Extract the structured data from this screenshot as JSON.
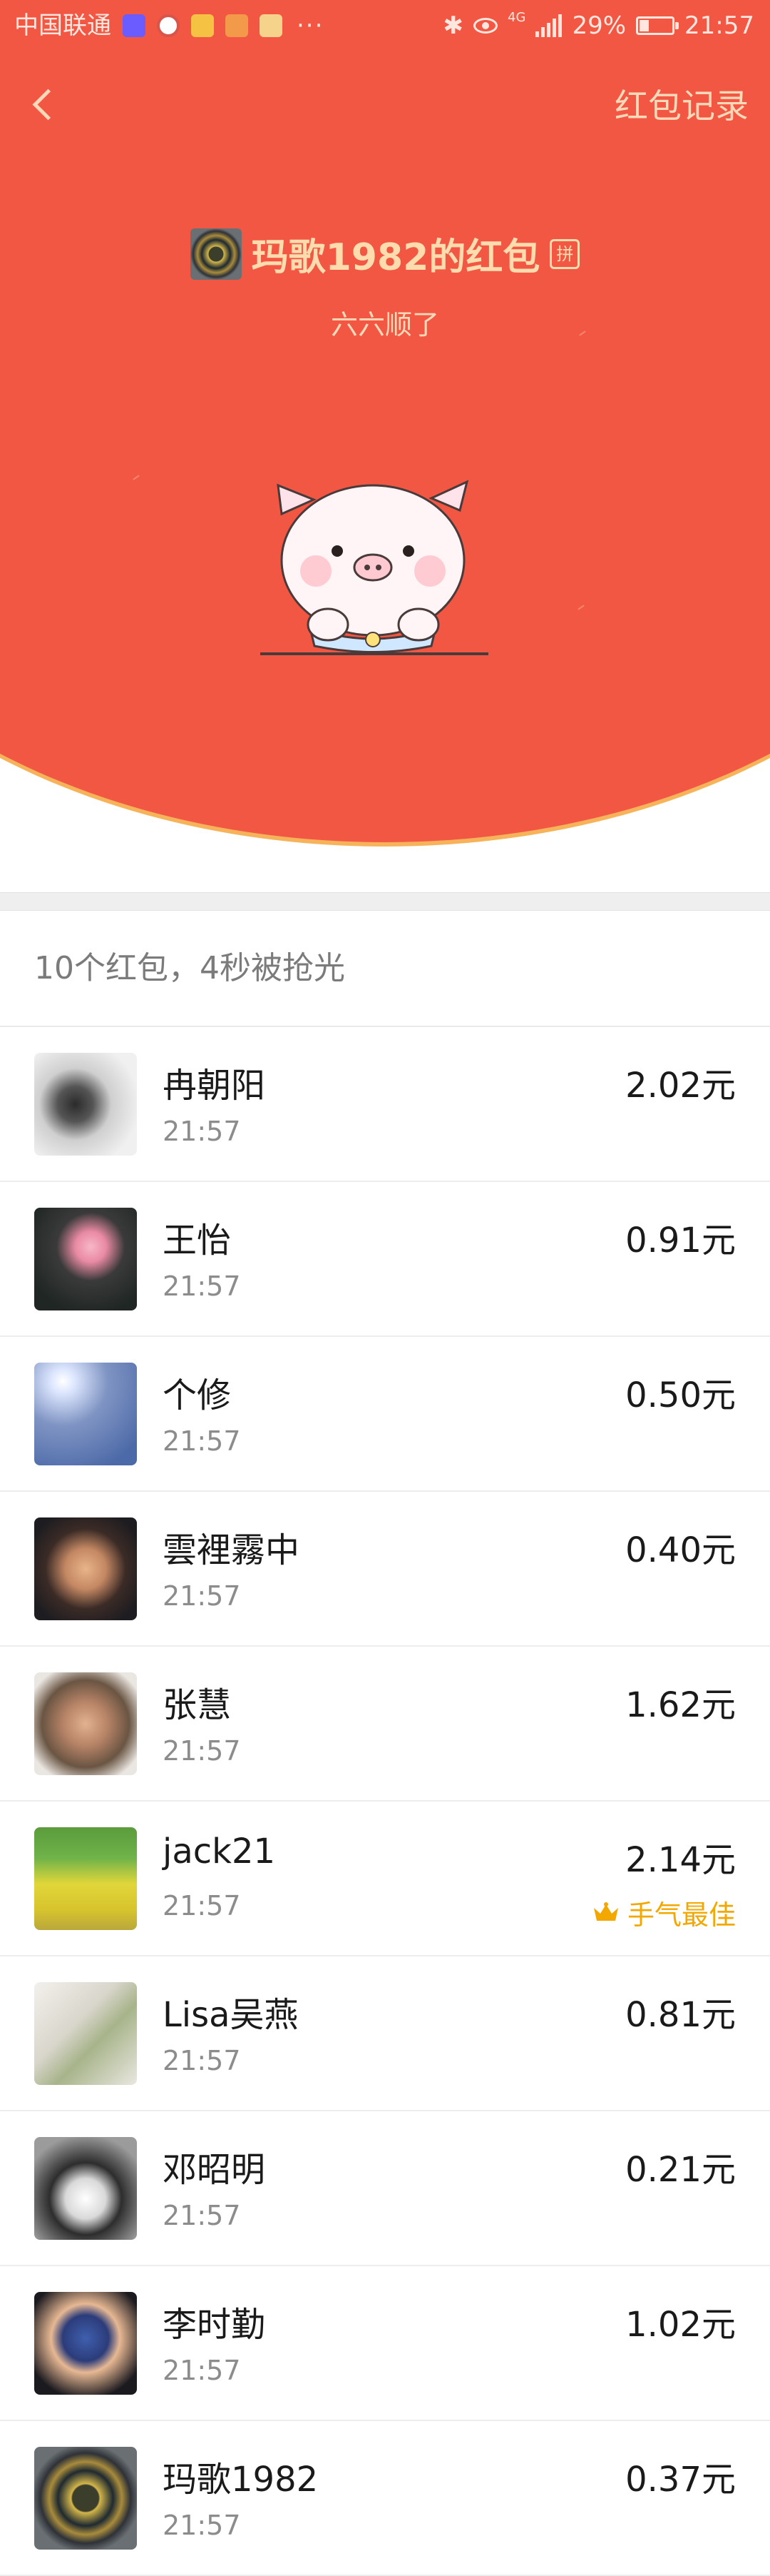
{
  "status_bar": {
    "carrier": "中国联通",
    "battery": "29%",
    "battery_level": 0.29,
    "time": "21:57",
    "dots": "···",
    "network": "4G"
  },
  "nav": {
    "back_icon": "chevron-left-icon",
    "record_label": "红包记录"
  },
  "sender": {
    "title": "玛歌1982的红包",
    "pin_label": "拼",
    "wish": "六六顺了"
  },
  "summary": "10个红包，4秒被抢光",
  "colors": {
    "header_red": "#f25744",
    "gold_text": "#ffdcae",
    "best_luck": "#f2a800"
  },
  "recipients": [
    {
      "name": "冉朝阳",
      "time": "21:57",
      "amount": "2.02元"
    },
    {
      "name": "王怡",
      "time": "21:57",
      "amount": "0.91元"
    },
    {
      "name": "个修",
      "time": "21:57",
      "amount": "0.50元"
    },
    {
      "name": "雲裡霧中",
      "time": "21:57",
      "amount": "0.40元"
    },
    {
      "name": "张慧",
      "time": "21:57",
      "amount": "1.62元"
    },
    {
      "name": "jack21",
      "time": "21:57",
      "amount": "2.14元",
      "best": "手气最佳"
    },
    {
      "name": "Lisa吴燕",
      "time": "21:57",
      "amount": "0.81元"
    },
    {
      "name": "邓昭明",
      "time": "21:57",
      "amount": "0.21元"
    },
    {
      "name": "李时勤",
      "time": "21:57",
      "amount": "1.02元"
    },
    {
      "name": "玛歌1982",
      "time": "21:57",
      "amount": "0.37元"
    }
  ]
}
